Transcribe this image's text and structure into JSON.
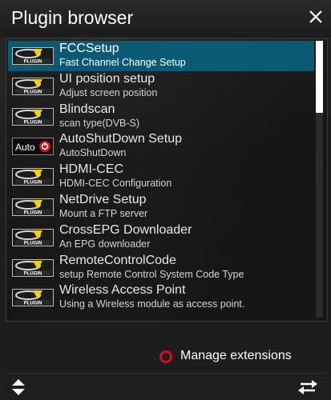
{
  "window": {
    "title": "Plugin browser"
  },
  "plugins": [
    {
      "name": "FCCSetup",
      "description": "Fast Channel Change Setup",
      "icon": "plugin-icon",
      "selected": true
    },
    {
      "name": "UI position setup",
      "description": "Adjust screen position",
      "icon": "plugin-icon"
    },
    {
      "name": "Blindscan",
      "description": "scan type(DVB-S)",
      "icon": "plugin-icon"
    },
    {
      "name": "AutoShutDown Setup",
      "description": "AutoShutDown",
      "icon": "auto-power-icon",
      "icon_text": "Auto"
    },
    {
      "name": "HDMI-CEC",
      "description": "HDMI-CEC Configuration",
      "icon": "plugin-icon"
    },
    {
      "name": "NetDrive Setup",
      "description": "Mount a FTP server",
      "icon": "plugin-icon"
    },
    {
      "name": "CrossEPG Downloader",
      "description": "An EPG downloader",
      "icon": "plugin-icon"
    },
    {
      "name": "RemoteControlCode",
      "description": "setup Remote Control System Code Type",
      "icon": "plugin-icon"
    },
    {
      "name": "Wireless Access Point",
      "description": "Using a Wireless module as access point.",
      "icon": "plugin-icon"
    }
  ],
  "plugin_icon_text": "PLUGIN",
  "footer": {
    "manage_label": "Manage extensions",
    "button_color": "#d3101a"
  },
  "colors": {
    "selection": "#0b5a74",
    "accent_red": "#d3101a"
  }
}
